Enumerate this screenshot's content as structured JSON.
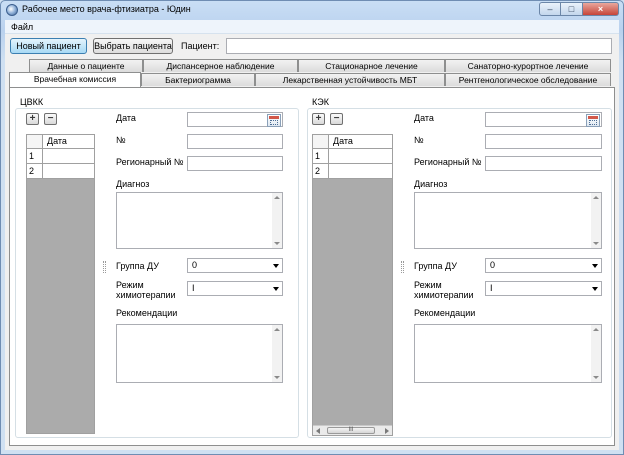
{
  "window": {
    "title": "Рабочее место врача-фтизиатра - Юдин",
    "controls": [
      "minimize-icon",
      "maximize-icon",
      "close-icon"
    ]
  },
  "menu": {
    "file": "Файл"
  },
  "toolbar": {
    "new_patient": "Новый пациент",
    "select_patient": "Выбрать пациента",
    "patient_label": "Пациент:",
    "patient_value": ""
  },
  "tabs": {
    "row_top": [
      "Данные о пациенте",
      "Диспансерное наблюдение",
      "Стационарное лечение",
      "Санаторно-курортное лечение"
    ],
    "row_bottom": [
      "Врачебная комиссия",
      "Бактериограмма",
      "Лекарственная устойчивость МБТ",
      "Рентгенологическое обследование"
    ],
    "active": "Врачебная комиссия"
  },
  "panels": {
    "cvkk": {
      "title": "ЦВКК",
      "grid_header": "Дата",
      "rows": [
        "1",
        "2"
      ],
      "date_label": "Дата",
      "number_label": "№",
      "regional_label": "Регионарный №",
      "diagnosis_label": "Диагноз",
      "group_label": "Группа ДУ",
      "group_value": "0",
      "regime_label_1": "Режим",
      "regime_label_2": "химиотерапии",
      "regime_value": "I",
      "recommend_label": "Рекомендации"
    },
    "kek": {
      "title": "КЭК",
      "grid_header": "Дата",
      "rows": [
        "1",
        "2"
      ],
      "scroll_thumb": "III",
      "date_label": "Дата",
      "number_label": "№",
      "regional_label": "Регионарный №",
      "diagnosis_label": "Диагноз",
      "group_label": "Группа ДУ",
      "group_value": "0",
      "regime_label_1": "Режим",
      "regime_label_2": "химиотерапии",
      "regime_value": "I",
      "recommend_label": "Рекомендации"
    }
  },
  "icons": {
    "add": "plus-icon",
    "remove": "minus-icon",
    "calendar": "calendar-icon"
  }
}
